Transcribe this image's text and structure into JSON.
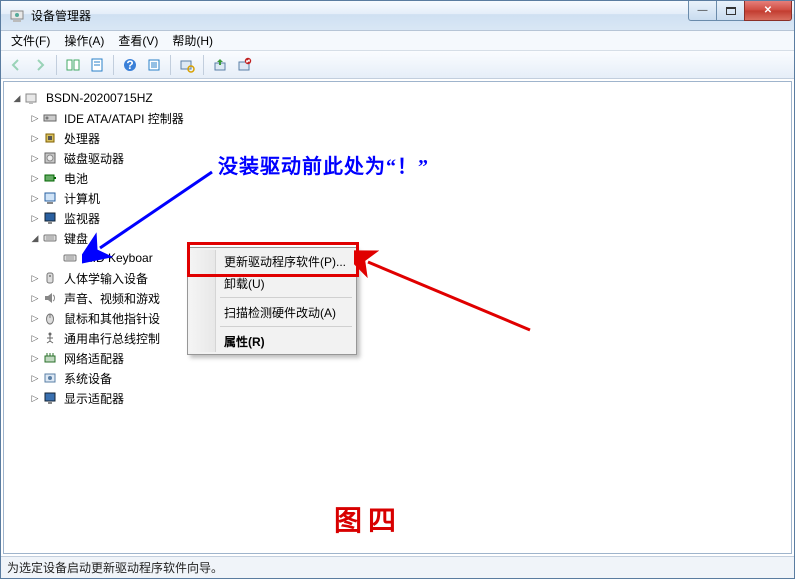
{
  "window": {
    "title": "设备管理器"
  },
  "menubar": {
    "file": "文件(F)",
    "action": "操作(A)",
    "view": "查看(V)",
    "help": "帮助(H)"
  },
  "toolbar_icons": [
    "back",
    "forward",
    "up",
    "show-hide",
    "help",
    "properties",
    "list",
    "scan",
    "update",
    "uninstall"
  ],
  "tree": {
    "root": "BSDN-20200715HZ",
    "items": [
      {
        "label": "IDE ATA/ATAPI 控制器",
        "icon": "ide"
      },
      {
        "label": "处理器",
        "icon": "cpu"
      },
      {
        "label": "磁盘驱动器",
        "icon": "disk"
      },
      {
        "label": "电池",
        "icon": "battery"
      },
      {
        "label": "计算机",
        "icon": "computer"
      },
      {
        "label": "监视器",
        "icon": "monitor"
      },
      {
        "label": "键盘",
        "icon": "keyboard",
        "expanded": true,
        "children": [
          {
            "label": "HID Keyboar",
            "icon": "keyboard"
          }
        ]
      },
      {
        "label": "人体学输入设备",
        "icon": "hid"
      },
      {
        "label": "声音、视频和游戏",
        "icon": "sound"
      },
      {
        "label": "鼠标和其他指针设",
        "icon": "mouse"
      },
      {
        "label": "通用串行总线控制",
        "icon": "usb"
      },
      {
        "label": "网络适配器",
        "icon": "network"
      },
      {
        "label": "系统设备",
        "icon": "system"
      },
      {
        "label": "显示适配器",
        "icon": "display"
      }
    ]
  },
  "context_menu": {
    "update": "更新驱动程序软件(P)...",
    "uninstall": "卸载(U)",
    "scan": "扫描检测硬件改动(A)",
    "properties": "属性(R)"
  },
  "annotations": {
    "note": "没装驱动前此处为“！”",
    "figure": "图四"
  },
  "statusbar": {
    "text": "为选定设备启动更新驱动程序软件向导。"
  },
  "colors": {
    "annotation_blue": "#0000ff",
    "annotation_red": "#e00000"
  }
}
